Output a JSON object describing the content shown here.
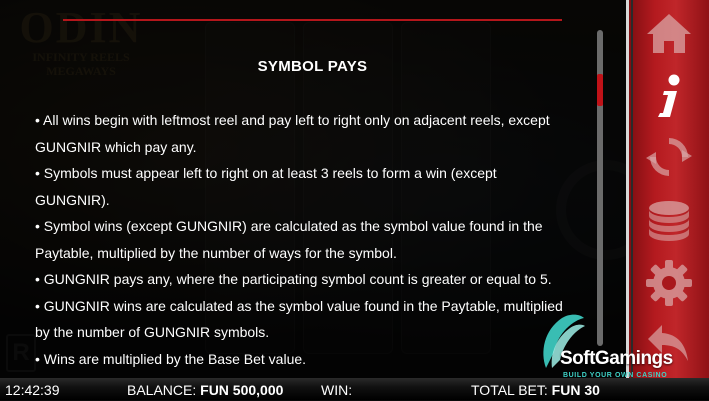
{
  "background_logo": {
    "title": "ODIN",
    "subtitle": "INFINITY REELS",
    "tagline": "MEGAWAYS"
  },
  "paytable": {
    "title": "SYMBOL PAYS",
    "lines": [
      "• All wins begin with leftmost reel and pay left to right only on adjacent reels, except GUNGNIR which pay any.",
      "• Symbols must appear left to right on at least 3 reels to form a win (except GUNGNIR).",
      "• Symbol wins (except GUNGNIR) are calculated as the symbol value found in the Paytable, multiplied by the number of ways for the symbol.",
      "• GUNGNIR pays any, where the participating symbol count is greater or equal to 5.",
      "• GUNGNIR wins are calculated as the symbol value found in the Paytable, multiplied by the number of GUNGNIR symbols.",
      "• Wins are multiplied by the Base Bet value."
    ]
  },
  "side_menu": {
    "items": [
      {
        "icon": "home-icon",
        "active": false
      },
      {
        "icon": "info-icon",
        "active": true
      },
      {
        "icon": "autoplay-icon",
        "active": false
      },
      {
        "icon": "coins-icon",
        "active": false
      },
      {
        "icon": "gear-icon",
        "active": false
      },
      {
        "icon": "back-icon",
        "active": false
      }
    ],
    "accent": "#b41a1f"
  },
  "brand": {
    "name": "SoftGamings",
    "tagline": "BUILD YOUR OWN CASINO"
  },
  "status_bar": {
    "clock": "12:42:39",
    "balance_label": "BALANCE:",
    "balance_value": "FUN 500,000",
    "win_label": "WIN:",
    "win_value": "",
    "total_bet_label": "TOTAL BET:",
    "total_bet_value": "FUN 30"
  },
  "colors": {
    "accent_red": "#b4161b",
    "brand_teal": "#3fd2c7"
  }
}
